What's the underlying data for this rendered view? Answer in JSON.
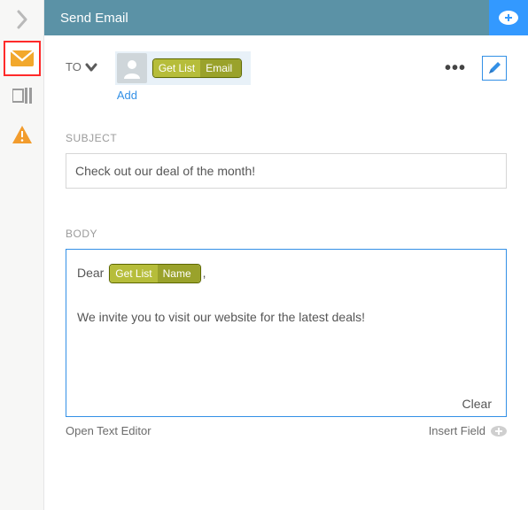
{
  "header": {
    "title": "Send Email"
  },
  "sidebar": {
    "icons": [
      "chevron-right-icon",
      "envelope-icon",
      "columns-icon",
      "warning-icon"
    ]
  },
  "to": {
    "label": "TO",
    "add": "Add",
    "contact_chip": {
      "c1": "Get List",
      "c2": "Email"
    }
  },
  "subject": {
    "label": "SUBJECT",
    "value": "Check out our deal of the month!"
  },
  "body": {
    "label": "BODY",
    "greeting": "Dear",
    "greeting_suffix": ",",
    "chip": {
      "c1": "Get List",
      "c2": "Name"
    },
    "paragraph": "We invite you to visit our website for the latest deals!",
    "clear": "Clear"
  },
  "footer": {
    "open_editor": "Open Text Editor",
    "insert_field": "Insert Field"
  },
  "colors": {
    "accent": "#3390e6",
    "chip_light": "#b6bd3a",
    "chip_dark": "#9aa22b",
    "header": "#5b92a6",
    "header_plus": "#3399ff"
  }
}
